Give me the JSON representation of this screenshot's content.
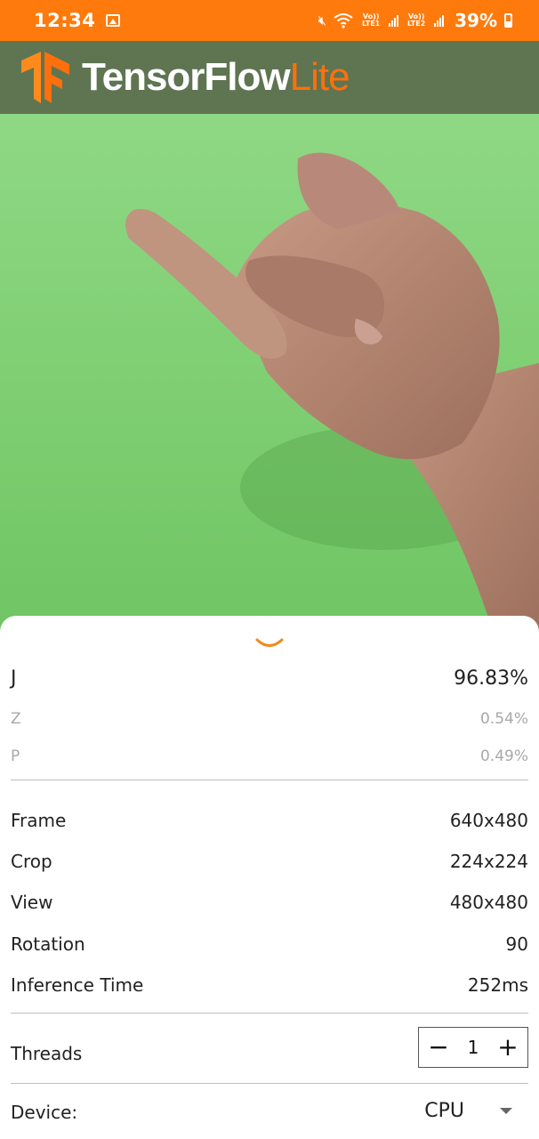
{
  "status_bar": {
    "time": "12:34",
    "net1": "Vo)) LTE1",
    "net2": "Vo)) LTE2",
    "battery": "39%"
  },
  "app_bar": {
    "brand_main": "TensorFlow",
    "brand_accent": "Lite",
    "accent_color": "#ff6f0c"
  },
  "results": [
    {
      "label": "J",
      "value": "96.83%"
    },
    {
      "label": "Z",
      "value": "0.54%"
    },
    {
      "label": "P",
      "value": "0.49%"
    }
  ],
  "info": [
    {
      "label": "Frame",
      "value": "640x480"
    },
    {
      "label": "Crop",
      "value": "224x224"
    },
    {
      "label": "View",
      "value": "480x480"
    },
    {
      "label": "Rotation",
      "value": "90"
    },
    {
      "label": "Inference Time",
      "value": "252ms"
    }
  ],
  "threads": {
    "label": "Threads",
    "minus": "−",
    "value": "1",
    "plus": "+"
  },
  "device": {
    "label": "Device:",
    "value": "CPU"
  }
}
